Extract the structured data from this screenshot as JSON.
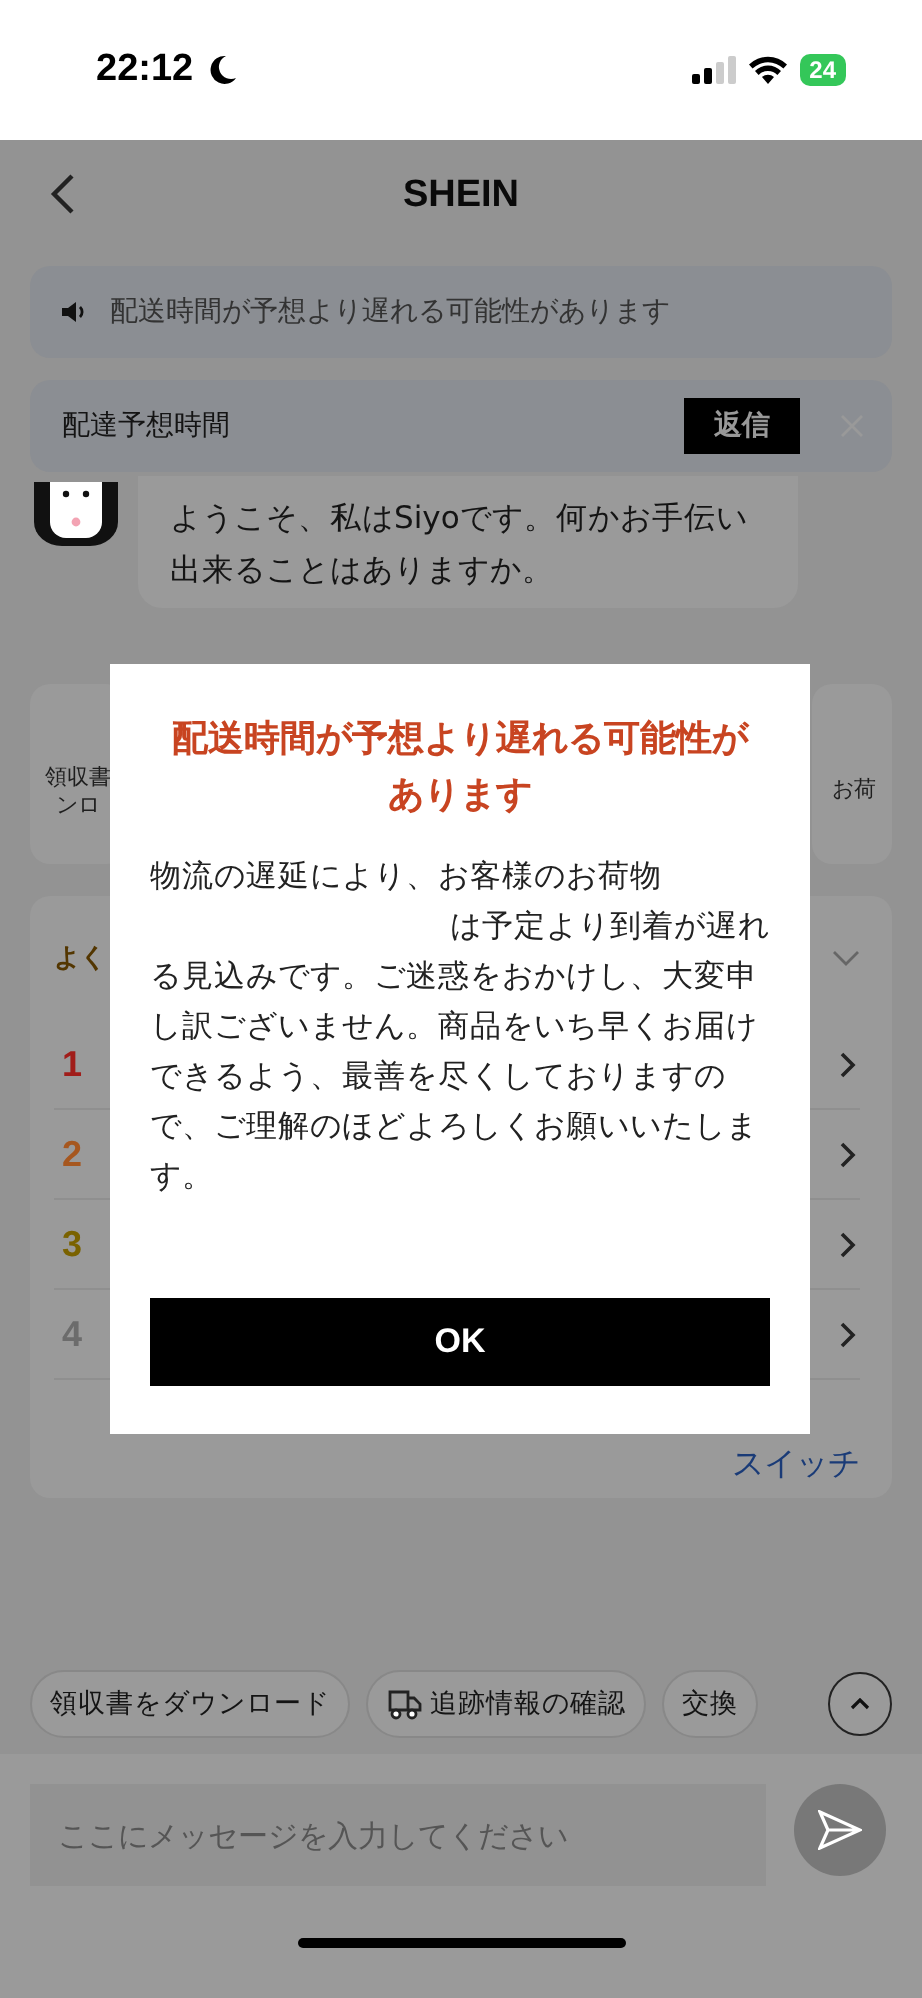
{
  "status_bar": {
    "time": "22:12",
    "battery": "24"
  },
  "header": {
    "title": "SHEIN"
  },
  "notice": {
    "text": "配送時間が予想より遅れる可能性があります"
  },
  "delivery_bar": {
    "label": "配達予想時間",
    "button": "返信"
  },
  "chat": {
    "message": "ようこそ、私はSiyoです。何かお手伝い出来ることはありますか。"
  },
  "shortcuts": [
    {
      "label_lines": [
        "領収書",
        "ンロ"
      ]
    },
    {
      "label_lines": [
        "お荷"
      ]
    }
  ],
  "faq": {
    "title": "よく",
    "items": [
      {
        "number": "1",
        "color": "#a11d1a"
      },
      {
        "number": "2",
        "color": "#a6571f"
      },
      {
        "number": "3",
        "color": "#7a6200"
      },
      {
        "number": "4",
        "color": "#6c6c6c"
      }
    ],
    "switch": "スイッチ"
  },
  "chips": [
    {
      "kind": "plain",
      "label": "領収書をダウンロード"
    },
    {
      "kind": "truck",
      "label": "追跡情報の確認"
    },
    {
      "kind": "plain",
      "label": "交換"
    }
  ],
  "input": {
    "placeholder": "ここにメッセージを入力してください"
  },
  "dialog": {
    "title": "配送時間が予想より遅れる可能性があります",
    "body": [
      "物流の遅延により、お客様のお荷物",
      "は予定より到着が遅れる見込みです。ご迷惑をおかけし、大変申し訳ございません。商品をいち早くお届けできるよう、最善を尽くしておりますので、ご理解のほどよろしくお願いいたします。"
    ],
    "button": "OK"
  }
}
